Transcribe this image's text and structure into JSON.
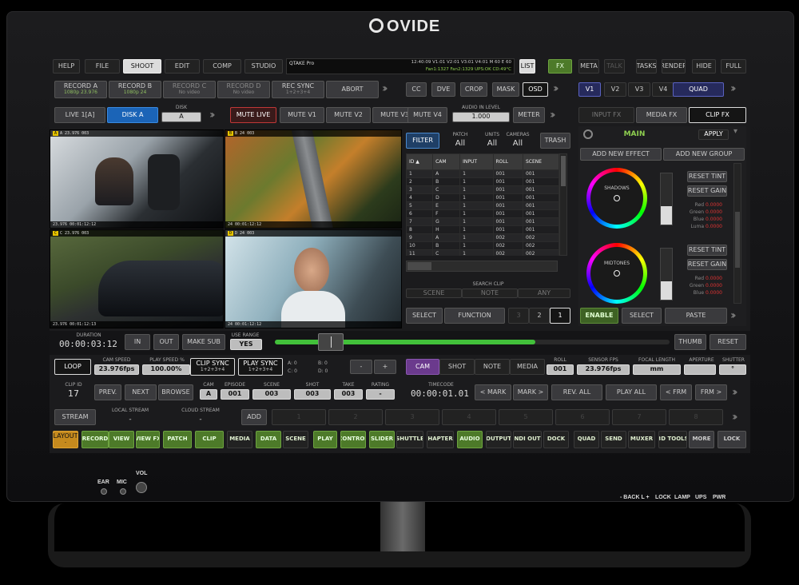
{
  "brand": "OVIDE",
  "menu": {
    "items": [
      "HELP",
      "FILE",
      "SHOOT",
      "EDIT",
      "COMP",
      "STUDIO"
    ],
    "active": "SHOOT"
  },
  "status": {
    "app": "QTAKE Pro",
    "line1": "12:40:09 V1:01 V2:01 V3:01 V4:01 M 60 E 60",
    "line2": "Fan1:1327 Fan2:1329 UPS:OK CD:49°C"
  },
  "top_right": {
    "list": "LIST",
    "fx": "FX",
    "meta": "META",
    "talk": "TALK",
    "tasks": "TASKS",
    "render": "RENDER",
    "hide": "HIDE",
    "full": "FULL"
  },
  "record": [
    {
      "label": "RECORD A",
      "sub": "1080p 23.976"
    },
    {
      "label": "RECORD B",
      "sub": "1080p 24"
    },
    {
      "label": "RECORD C",
      "sub": "No video"
    },
    {
      "label": "RECORD D",
      "sub": "No video"
    },
    {
      "label": "REC SYNC",
      "sub": "1+2+3+4"
    },
    {
      "label": "ABORT",
      "sub": ""
    }
  ],
  "tools": [
    "CC",
    "DVE",
    "CROP",
    "MASK",
    "OSD"
  ],
  "views": [
    "V1",
    "V2",
    "V3",
    "V4",
    "QUAD"
  ],
  "row3": {
    "live": "LIVE 1[A]",
    "disk": "DISK A",
    "disk_label": "DISK",
    "disk_value": "A",
    "mute_live": "MUTE LIVE",
    "mute_v1": "MUTE V1",
    "mute_v2": "MUTE V2",
    "mute_v3": "MUTE V3",
    "mute_v4": "MUTE V4",
    "audio_label": "AUDIO IN LEVEL",
    "audio_value": "1.000",
    "meter": "METER"
  },
  "fx_tabs": [
    "INPUT FX",
    "MEDIA FX",
    "CLIP FX"
  ],
  "fx": {
    "main": "MAIN",
    "apply": "APPLY",
    "add_effect": "ADD NEW EFFECT",
    "add_group": "ADD NEW GROUP",
    "reset_tint": "RESET TINT",
    "reset_gain": "RESET GAIN",
    "shadows": "SHADOWS",
    "midtones": "MIDTONES",
    "rgb_labels": [
      "Red",
      "Green",
      "Blue",
      "Luma"
    ],
    "rgb_values": [
      "0.0000",
      "0.0000",
      "0.0000",
      "0.0000"
    ],
    "enable": "ENABLE",
    "select": "SELECT",
    "paste": "PASTE"
  },
  "videos": [
    {
      "top": "A   23.976  003",
      "bottom": "23.976          00:01:12:12",
      "time": "00:01:12:12"
    },
    {
      "top": "B   24  003",
      "bottom": "24              00:01:12:12",
      "time": "00:01:12:12"
    },
    {
      "top": "C   23.976  003",
      "bottom": "23.976          00:01:12:13",
      "time": "00:01:12:13"
    },
    {
      "top": "D   24  003",
      "bottom": "24              00:01:12:12",
      "time": "00:01:12:12"
    }
  ],
  "list": {
    "filter": "FILTER",
    "patch_label": "PATCH",
    "patch": "All",
    "units_label": "UNITS",
    "units": "All",
    "cameras_label": "CAMERAS",
    "cameras": "All",
    "trash": "TRASH",
    "columns": [
      "ID",
      "CAM",
      "INPUT",
      "ROLL",
      "SCENE"
    ],
    "rows": [
      [
        "1",
        "A",
        "1",
        "001",
        "001"
      ],
      [
        "2",
        "B",
        "1",
        "001",
        "001"
      ],
      [
        "3",
        "C",
        "1",
        "001",
        "001"
      ],
      [
        "4",
        "D",
        "1",
        "001",
        "001"
      ],
      [
        "5",
        "E",
        "1",
        "001",
        "001"
      ],
      [
        "6",
        "F",
        "1",
        "001",
        "001"
      ],
      [
        "7",
        "G",
        "1",
        "001",
        "001"
      ],
      [
        "8",
        "H",
        "1",
        "001",
        "001"
      ],
      [
        "9",
        "A",
        "1",
        "002",
        "002"
      ],
      [
        "10",
        "B",
        "1",
        "002",
        "002"
      ],
      [
        "11",
        "C",
        "1",
        "002",
        "002"
      ]
    ],
    "search_label": "SEARCH CLIP",
    "search": [
      "SCENE",
      "NOTE",
      "ANY"
    ],
    "select": "SELECT",
    "function": "FUNCTION",
    "pages": [
      "3",
      "2",
      "1"
    ]
  },
  "transport": {
    "duration_label": "DURATION",
    "duration": "00:00:03:12",
    "in": "IN",
    "out": "OUT",
    "make_sub": "MAKE SUB",
    "use_range_label": "USE RANGE",
    "use_range": "YES",
    "thumb": "THUMB",
    "reset": "RESET",
    "progress": 0.66
  },
  "play": {
    "loop": "LOOP",
    "cam_speed_label": "CAM SPEED",
    "cam_speed": "23.976fps",
    "play_speed_label": "PLAY SPEED %",
    "play_speed": "100.00%",
    "clip_sync": "CLIP SYNC",
    "clip_sync_sub": "1+2+3+4",
    "play_sync": "PLAY SYNC",
    "play_sync_sub": "1+2+3+4",
    "a": "A: 0",
    "b": "B: 0",
    "c": "C: 0",
    "d": "D: 0",
    "minus": "-",
    "plus": "+"
  },
  "meta_tabs": [
    "CAM",
    "SHOT",
    "NOTE",
    "MEDIA"
  ],
  "meta": {
    "roll_label": "ROLL",
    "roll": "001",
    "sensor_label": "SENSOR FPS",
    "sensor": "23.976fps",
    "focal_label": "FOCAL LENGTH",
    "focal": "mm",
    "aperture_label": "APERTURE",
    "aperture": "",
    "shutter_label": "SHUTTER",
    "shutter": "°"
  },
  "clip": {
    "id_label": "CLIP ID",
    "id": "17",
    "prev": "PREV.",
    "next": "NEXT",
    "browse": "BROWSE",
    "cam_label": "CAM",
    "cam": "A",
    "episode_label": "EPISODE",
    "episode": "001",
    "scene_label": "SCENE",
    "scene": "003",
    "shot_label": "SHOT",
    "shot": "003",
    "take_label": "TAKE",
    "take": "003",
    "rating_label": "RATING",
    "rating": "-",
    "timecode_label": "TIMECODE",
    "timecode": "00:00:01.01",
    "marks": [
      "< MARK",
      "MARK >",
      "REV. ALL",
      "PLAY ALL",
      "< FRM",
      "FRM >"
    ]
  },
  "stream": {
    "stream": "STREAM",
    "local_label": "LOCAL STREAM",
    "local": "-",
    "cloud_label": "CLOUD STREAM",
    "cloud": "-",
    "add": "ADD",
    "slots": [
      "1",
      "2",
      "3",
      "4",
      "5",
      "6",
      "7",
      "8"
    ]
  },
  "bottom": {
    "layout": "LAYOUT",
    "layout_sub": "-",
    "items": [
      "RECORD",
      "VIEW",
      "VIEW FX",
      "PATCH",
      "CLIP",
      "MEDIA",
      "DATA",
      "SCENE",
      "PLAY",
      "CONTROL",
      "SLIDER",
      "SHUTTLE",
      "CHAPTERS",
      "AUDIO",
      "OUTPUT",
      "NDI OUT",
      "DOCK",
      "QUAD",
      "SEND",
      "MUXER",
      "3D TOOLS",
      "MORE",
      "LOCK"
    ]
  },
  "hardware": {
    "ear": "EAR",
    "mic": "MIC",
    "vol": "VOL",
    "back": "- BACK L +",
    "lock": "LOCK",
    "lamp": "LAMP",
    "ups": "UPS",
    "pwr": "PWR"
  }
}
